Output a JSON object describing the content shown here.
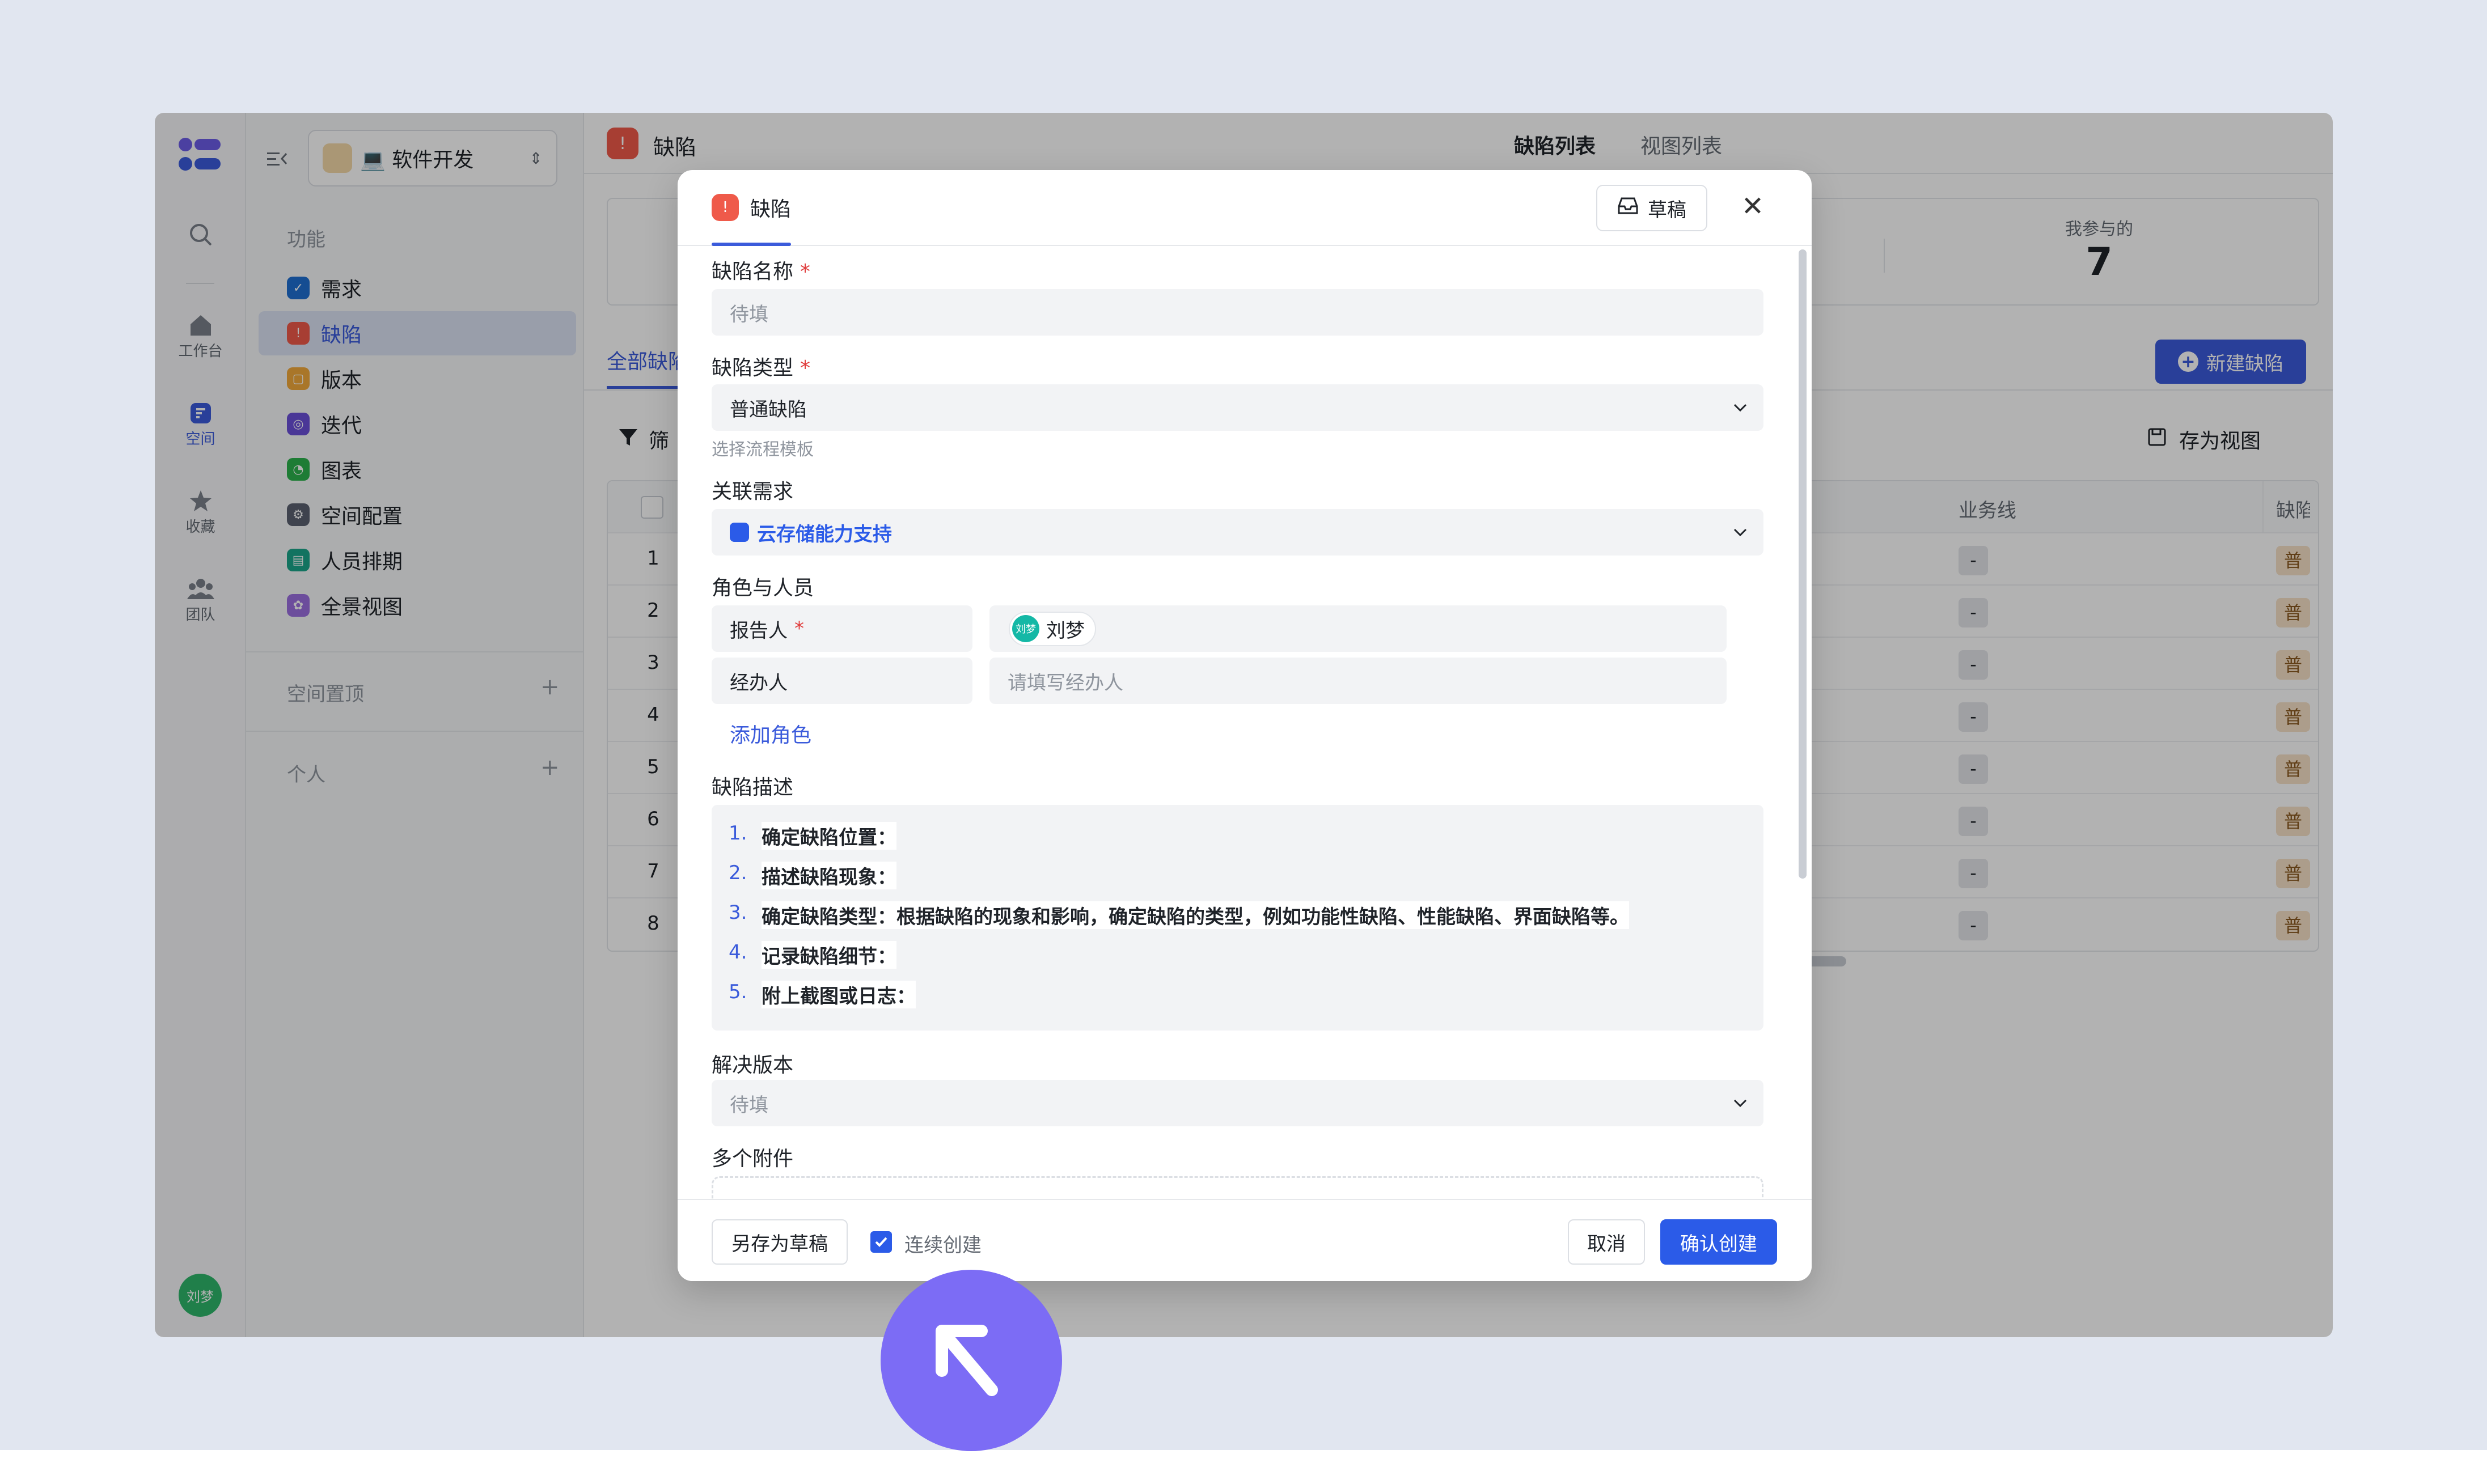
{
  "rail": {
    "items": [
      {
        "label": "工作台",
        "icon": "home-icon"
      },
      {
        "label": "空间",
        "icon": "space-icon"
      },
      {
        "label": "收藏",
        "icon": "star-icon"
      },
      {
        "label": "团队",
        "icon": "team-icon"
      }
    ],
    "user_avatar": "刘梦"
  },
  "sidebar": {
    "space_selector": "💻 软件开发",
    "section_functions": "功能",
    "items": [
      {
        "label": "需求",
        "color": "#1f6fd1"
      },
      {
        "label": "缺陷",
        "color": "#ef5a4a"
      },
      {
        "label": "版本",
        "color": "#f2a93b"
      },
      {
        "label": "迭代",
        "color": "#6b4fd8"
      },
      {
        "label": "图表",
        "color": "#2bb24c"
      },
      {
        "label": "空间配置",
        "color": "#5b6170"
      },
      {
        "label": "人员排期",
        "color": "#1aa58a"
      },
      {
        "label": "全景视图",
        "color": "#9b6fe0"
      }
    ],
    "section_pinned": "空间置顶",
    "section_personal": "个人"
  },
  "main": {
    "title": "缺陷",
    "tabs": [
      "缺陷列表",
      "视图列表"
    ],
    "stat_label": "我参与的",
    "stat_value": "7",
    "filter_tab": "全部缺陷",
    "filter_label": "筛",
    "new_button": "新建缺陷",
    "save_view": "存为视图",
    "columns": [
      "业务线",
      "缺陷"
    ],
    "rows": [
      "1",
      "2",
      "3",
      "4",
      "5",
      "6",
      "7",
      "8"
    ],
    "dash": "-",
    "type_badge": "普通"
  },
  "modal": {
    "title": "缺陷",
    "draft_button": "草稿",
    "name_label": "缺陷名称",
    "name_placeholder": "待填",
    "type_label": "缺陷类型",
    "type_value": "普通缺陷",
    "type_hint": "选择流程模板",
    "related_label": "关联需求",
    "related_value": "云存储能力支持",
    "roles_label": "角色与人员",
    "reporter_label": "报告人",
    "reporter_name": "刘梦",
    "reporter_avatar": "刘梦",
    "assignee_label": "经办人",
    "assignee_placeholder": "请填写经办人",
    "add_role": "添加角色",
    "desc_label": "缺陷描述",
    "desc_items": [
      {
        "num": "1.",
        "text": "确定缺陷位置："
      },
      {
        "num": "2.",
        "text": "描述缺陷现象："
      },
      {
        "num": "3.",
        "text": "确定缺陷类型：根据缺陷的现象和影响，确定缺陷的类型，例如功能性缺陷、性能缺陷、界面缺陷等。"
      },
      {
        "num": "4.",
        "text": "记录缺陷细节："
      },
      {
        "num": "5.",
        "text": "附上截图或日志："
      }
    ],
    "version_label": "解决版本",
    "version_placeholder": "待填",
    "attach_label": "多个附件",
    "save_draft": "另存为草稿",
    "continuous": "连续创建",
    "cancel": "取消",
    "confirm": "确认创建"
  }
}
